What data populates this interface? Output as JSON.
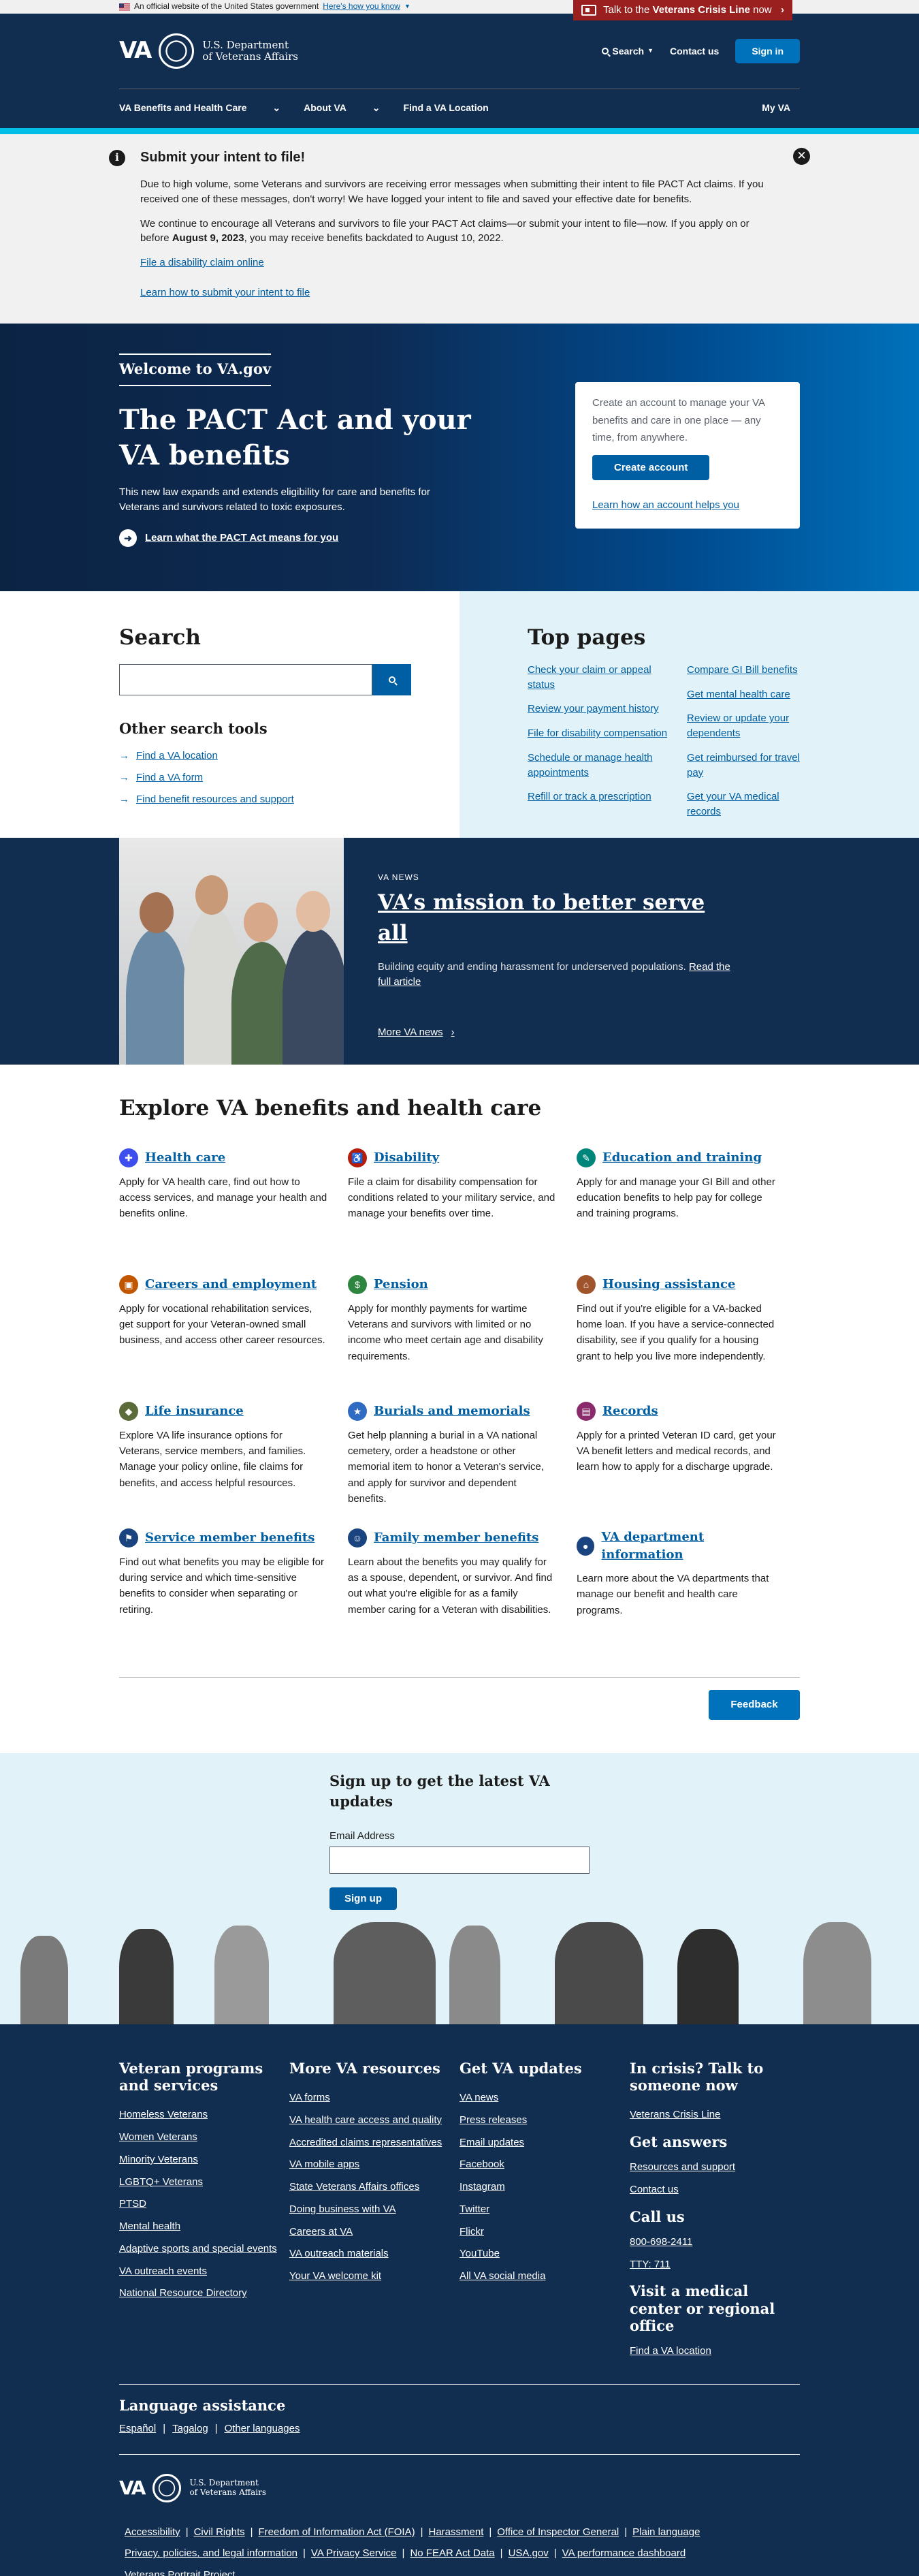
{
  "official": {
    "text": "An official website of the United States government",
    "link": "Here's how you know"
  },
  "crisis_tab": {
    "prefix": "Talk to the ",
    "bold": "Veterans Crisis Line",
    "suffix": " now"
  },
  "header": {
    "logo_line1": "U.S. Department",
    "logo_line2": "of Veterans Affairs",
    "search": "Search",
    "contact": "Contact us",
    "signin": "Sign in",
    "menu": [
      "VA Benefits and Health Care",
      "About VA",
      "Find a VA Location"
    ],
    "my_va": "My VA"
  },
  "alert": {
    "title": "Submit your intent to file!",
    "p1": "Due to high volume, some Veterans and survivors are receiving error messages when submitting their intent to file PACT Act claims. If you received one of these messages, don't worry! We have logged your intent to file and saved your effective date for benefits.",
    "p2_before": "We continue to encourage all Veterans and survivors to file your PACT Act claims—or submit your intent to file—now. If you apply on or before ",
    "p2_bold": "August 9, 2023",
    "p2_after": ", you may receive benefits backdated to August 10, 2022.",
    "link1": "File a disability claim online",
    "link2": "Learn how to submit your intent to file"
  },
  "hero": {
    "welcome": "Welcome to VA.gov",
    "title": "The PACT Act and your VA benefits",
    "desc": "This new law expands and extends eligibility for care and benefits for Veterans and survivors related to toxic exposures.",
    "link": "Learn what the PACT Act means for you",
    "account_text": "Create an account to manage your VA benefits and care in one place — any time, from anywhere.",
    "account_btn": "Create account",
    "account_link": "Learn how an account helps you"
  },
  "search": {
    "title": "Search",
    "tools_title": "Other search tools",
    "tools": [
      "Find a VA location",
      "Find a VA form",
      "Find benefit resources and support"
    ]
  },
  "top_pages": {
    "title": "Top pages",
    "left": [
      "Check your claim or appeal status",
      "Review your payment history",
      "File for disability compensation",
      "Schedule or manage health appointments",
      "Refill or track a prescription"
    ],
    "right": [
      "Compare GI Bill benefits",
      "Get mental health care",
      "Review or update your dependents",
      "Get reimbursed for travel pay",
      "Get your VA medical records"
    ]
  },
  "news": {
    "eyebrow": "VA NEWS",
    "title": "VA’s mission to better serve all",
    "desc": "Building equity and ending harassment for underserved populations. ",
    "desc_link": "Read the full article",
    "more": "More VA news"
  },
  "explore": {
    "title": "Explore VA benefits and health care",
    "items": [
      {
        "title": "Health care",
        "desc": "Apply for VA health care, find out how to access services, and manage your health and benefits online.",
        "icon": "health-care-icon",
        "color": "#3e4ded"
      },
      {
        "title": "Disability",
        "desc": "File a claim for disability compensation for conditions related to your military service, and manage your benefits over time.",
        "icon": "disability-icon",
        "color": "#b51d09"
      },
      {
        "title": "Education and training",
        "desc": "Apply for and manage your GI Bill and other education benefits to help pay for college and training programs.",
        "icon": "education-icon",
        "color": "#00857a"
      },
      {
        "title": "Careers and employment",
        "desc": "Apply for vocational rehabilitation services, get support for your Veteran-owned small business, and access other career resources.",
        "icon": "briefcase-icon",
        "color": "#c05600"
      },
      {
        "title": "Pension",
        "desc": "Apply for monthly payments for wartime Veterans and survivors with limited or no income who meet certain age and disability requirements.",
        "icon": "pension-icon",
        "color": "#2e8540"
      },
      {
        "title": "Housing assistance",
        "desc": "Find out if you're eligible for a VA-backed home loan. If you have a service-connected disability, see if you qualify for a housing grant to help you live more independently.",
        "icon": "house-icon",
        "color": "#a0542b"
      },
      {
        "title": "Life insurance",
        "desc": "Explore VA life insurance options for Veterans, service members, and families. Manage your policy online, file claims for benefits, and access helpful resources.",
        "icon": "shield-icon",
        "color": "#5b6b3a"
      },
      {
        "title": "Burials and memorials",
        "desc": "Get help planning a burial in a VA national cemetery, order a headstone or other memorial item to honor a Veteran's service, and apply for survivor and dependent benefits.",
        "icon": "star-icon",
        "color": "#2f6bc2"
      },
      {
        "title": "Records",
        "desc": "Apply for a printed Veteran ID card, get your VA benefit letters and medical records, and learn how to apply for a discharge upgrade.",
        "icon": "records-icon",
        "color": "#8a2a6b"
      },
      {
        "title": "Service member benefits",
        "desc": "Find out what benefits you may be eligible for during service and which time-sensitive benefits to consider when separating or retiring.",
        "icon": "flag-icon",
        "color": "#1a4480"
      },
      {
        "title": "Family member benefits",
        "desc": "Learn about the benefits you may qualify for as a spouse, dependent, or survivor. And find out what you're eligible for as a family member caring for a Veteran with disabilities.",
        "icon": "family-icon",
        "color": "#1a4480"
      },
      {
        "title": "VA department information",
        "desc": "Learn more about the VA departments that manage our benefit and health care programs.",
        "icon": "va-seal-icon",
        "color": "#1a4480"
      }
    ],
    "feedback": "Feedback"
  },
  "signup": {
    "title": "Sign up to get the latest VA updates",
    "label": "Email Address",
    "button": "Sign up"
  },
  "footer": {
    "col1_title": "Veteran programs and services",
    "col1": [
      "Homeless Veterans",
      "Women Veterans",
      "Minority Veterans",
      "LGBTQ+ Veterans",
      "PTSD",
      "Mental health",
      "Adaptive sports and special events",
      "VA outreach events",
      "National Resource Directory"
    ],
    "col2_title": "More VA resources",
    "col2": [
      "VA forms",
      "VA health care access and quality",
      "Accredited claims representatives",
      "VA mobile apps",
      "State Veterans Affairs offices",
      "Doing business with VA",
      "Careers at VA",
      "VA outreach materials",
      "Your VA welcome kit"
    ],
    "col3_title": "Get VA updates",
    "col3": [
      "VA news",
      "Press releases",
      "Email updates",
      "Facebook",
      "Instagram",
      "Twitter",
      "Flickr",
      "YouTube",
      "All VA social media"
    ],
    "crisis_title": "In crisis? Talk to someone now",
    "crisis_link": "Veterans Crisis Line",
    "answers_title": "Get answers",
    "answers": [
      "Resources and support",
      "Contact us"
    ],
    "call_title": "Call us",
    "phone": "800-698-2411",
    "tty": "TTY: 711",
    "visit_title": "Visit a medical center or regional office",
    "visit_link": "Find a VA location",
    "lang_title": "Language assistance",
    "langs": [
      "Español",
      "Tagalog",
      "Other languages"
    ],
    "bottom_links": [
      "Accessibility",
      "Civil Rights",
      "Freedom of Information Act (FOIA)",
      "Harassment",
      "Office of Inspector General",
      "Plain language",
      "Privacy, policies, and legal information",
      "VA Privacy Service",
      "No FEAR Act Data",
      "USA.gov",
      "VA performance dashboard",
      "Veterans Portrait Project"
    ]
  }
}
